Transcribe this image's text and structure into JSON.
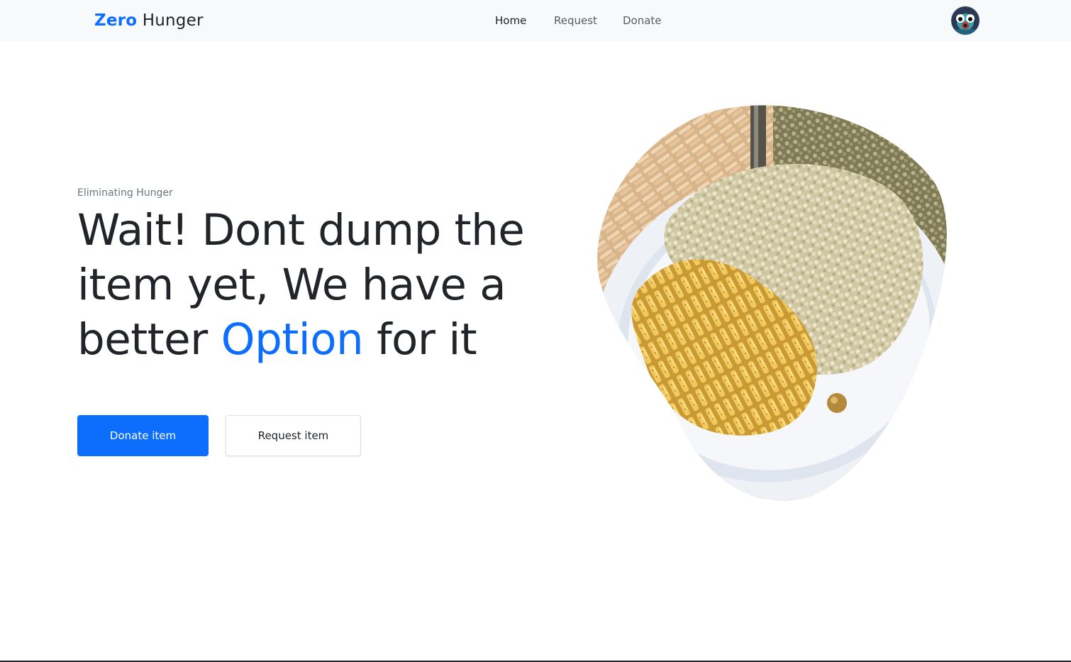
{
  "navbar": {
    "brand_accent": "Zero",
    "brand_rest": "Hunger",
    "links": [
      "Home",
      "Request",
      "Donate"
    ],
    "active_link": "Home"
  },
  "hero": {
    "eyebrow": "Eliminating Hunger",
    "headline_before": "Wait! Dont dump the item yet, We have a better",
    "headline_highlight": "Option",
    "headline_after": "for it",
    "primary_button": "Donate item",
    "secondary_button": "Request item",
    "image_icon": "pasta-plate-image"
  },
  "colors": {
    "accent": "#0d6efd",
    "navbar_bg": "#f8f9fa",
    "text": "#212529",
    "muted": "#6c757d"
  }
}
